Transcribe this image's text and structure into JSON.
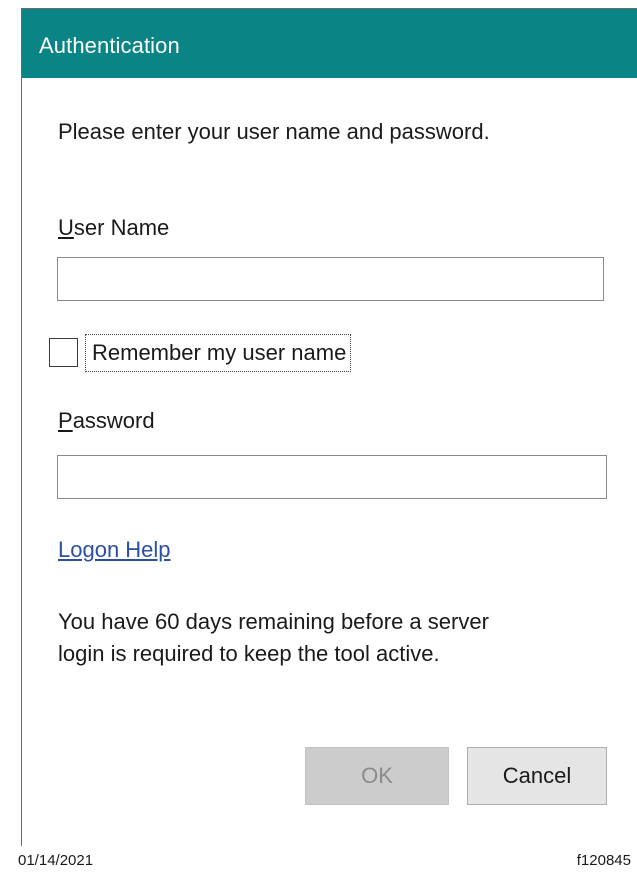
{
  "dialog": {
    "title": "Authentication",
    "prompt": "Please enter your user name and password.",
    "colors": {
      "titlebar": "#0a8484",
      "link": "#2c4fa6"
    }
  },
  "form": {
    "username": {
      "label_accel": "U",
      "label_rest": "ser Name",
      "value": ""
    },
    "remember": {
      "label": "Remember my user name",
      "checked": false
    },
    "password": {
      "label_accel": "P",
      "label_rest": "assword",
      "value": ""
    }
  },
  "links": {
    "logon_help": "Logon Help"
  },
  "info": {
    "line1": "You have 60 days remaining before a server",
    "line2": "login is required to keep the tool active."
  },
  "buttons": {
    "ok": "OK",
    "ok_disabled": true,
    "cancel": "Cancel"
  },
  "footer": {
    "date": "01/14/2021",
    "figure_id": "f120845"
  }
}
